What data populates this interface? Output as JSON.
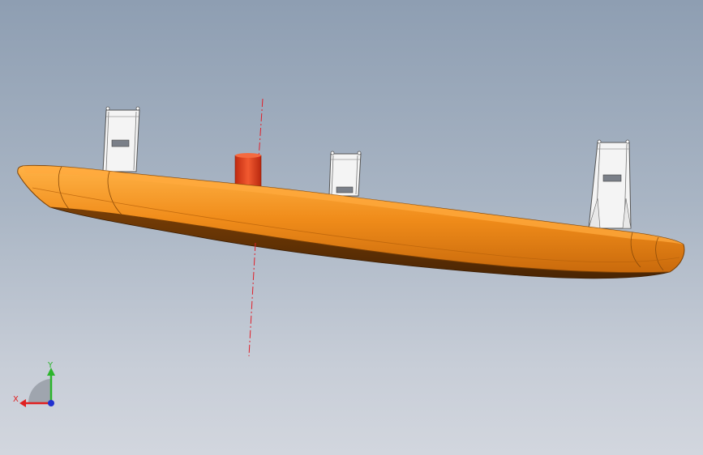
{
  "viewport": {
    "background_top": "#8e9eb2",
    "background_bottom": "#d2d6de"
  },
  "model": {
    "body_color": "#f08c1a",
    "body_shadow_color": "#5a2f05",
    "boss_color": "#e8401e",
    "clip_color": "#f4f4f4",
    "axis_line_color": "#e0202a",
    "clip_count": 3
  },
  "triad": {
    "x_label": "X",
    "y_label": "Y",
    "x_color": "#e02020",
    "y_color": "#2cb52c",
    "z_color": "#2030d0"
  }
}
